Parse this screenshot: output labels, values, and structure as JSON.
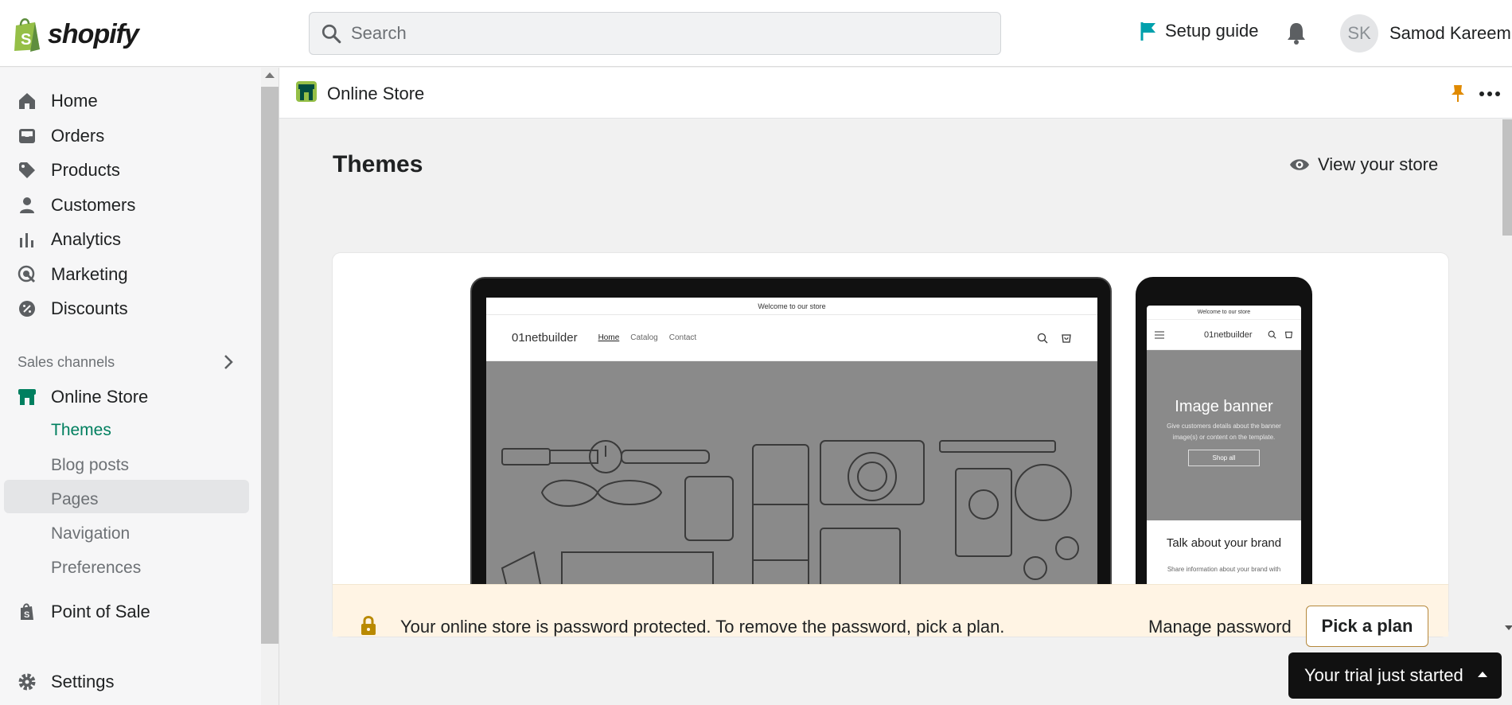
{
  "topbar": {
    "logo_text": "shopify",
    "search_placeholder": "Search",
    "setup_guide_label": "Setup guide",
    "avatar_initials": "SK",
    "user_name": "Samod Kareem"
  },
  "sidebar": {
    "items": [
      {
        "label": "Home",
        "icon": "home-icon"
      },
      {
        "label": "Orders",
        "icon": "orders-icon"
      },
      {
        "label": "Products",
        "icon": "tag-icon"
      },
      {
        "label": "Customers",
        "icon": "person-icon"
      },
      {
        "label": "Analytics",
        "icon": "bar-chart-icon"
      },
      {
        "label": "Marketing",
        "icon": "target-icon"
      },
      {
        "label": "Discounts",
        "icon": "discount-icon"
      }
    ],
    "sales_channels_label": "Sales channels",
    "online_store_label": "Online Store",
    "online_store_subitems": [
      "Themes",
      "Blog posts",
      "Pages",
      "Navigation",
      "Preferences"
    ],
    "active_subitem": "Themes",
    "point_of_sale_label": "Point of Sale",
    "settings_label": "Settings"
  },
  "main": {
    "header_title": "Online Store",
    "page_title": "Themes",
    "view_store_label": "View your store",
    "preview": {
      "announcement": "Welcome to our store",
      "store_name": "01netbuilder",
      "nav_links": [
        "Home",
        "Catalog",
        "Contact"
      ],
      "mobile_banner_title": "Image banner",
      "mobile_banner_text": "Give customers details about the banner image(s) or content on the template.",
      "mobile_banner_button": "Shop all",
      "mobile_talk_title": "Talk about your brand",
      "mobile_talk_text": "Share information about your brand with"
    },
    "banner": {
      "text": "Your online store is password protected. To remove the password, pick a plan.",
      "manage_password_label": "Manage password",
      "pick_plan_label": "Pick a plan"
    }
  },
  "trial_label": "Your trial just started",
  "colors": {
    "brand_green": "#007f5f",
    "shopify_green": "#95bf47",
    "banner_bg": "#fff4e4",
    "lock_gold": "#b98900",
    "flag_teal": "#00a0ac"
  }
}
